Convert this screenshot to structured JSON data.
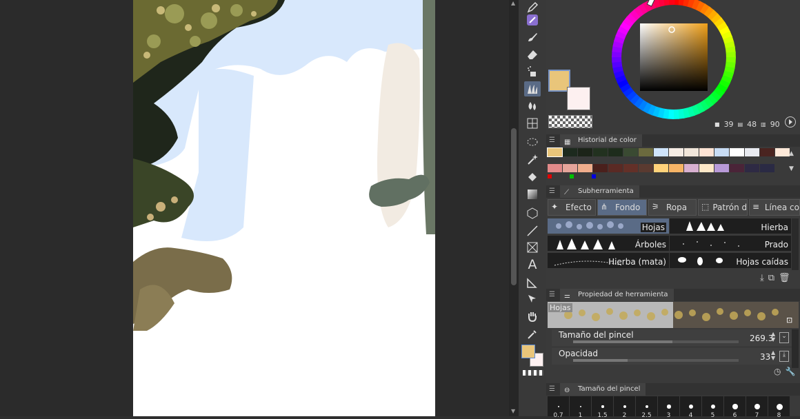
{
  "color_panel": {
    "main_color": "#e9c57a",
    "sub_color": "#fdf0f0",
    "values": {
      "h": "39",
      "s": "48",
      "v": "90"
    }
  },
  "color_history": {
    "title": "Historial de color",
    "row1": [
      "#e9c57a",
      "#1d2a1e",
      "#1c2419",
      "#22311f",
      "#1e2c1c",
      "#3a4a32",
      "#6b6a3e",
      "#cfe4fb",
      "#f5ece4",
      "#f1e6da",
      "#fde3d4",
      "#c8dcf4",
      "#ffffff",
      "#e8eaf0",
      "#4a2420",
      "#fde8d8"
    ],
    "row2": [
      "#e28a8a",
      "#e6a49a",
      "#f0ad8c",
      "#4a201c",
      "#5a2a24",
      "#633028",
      "#5a3a30",
      "#ffd27a",
      "#f6b466",
      "#d8b0d0",
      "#fde7c8",
      "#b89ad8",
      "#4a2438",
      "#2e2a44",
      "#2a2a44"
    ],
    "markers": [
      "#e00000",
      "#00c000",
      "#0000e0"
    ]
  },
  "subtool_panel": {
    "title": "Subherramienta",
    "tabs": [
      "Efecto",
      "Fondo",
      "Ropa",
      "Patrón de",
      "Línea co"
    ],
    "brushes": [
      "Hojas",
      "Hierba",
      "Árboles",
      "Prado",
      "Hierba (mata)",
      "Hojas caídas"
    ]
  },
  "tool_property": {
    "title": "Propiedad de herramienta",
    "preview_label": "Hojas",
    "brush_size_label": "Tamaño del pincel",
    "brush_size_value": "269.3",
    "brush_size_fraction": 0.6,
    "opacity_label": "Opacidad",
    "opacity_value": "33",
    "opacity_fraction": 0.33
  },
  "brush_size_panel": {
    "title": "Tamaño del pincel",
    "sizes": [
      "0.7",
      "1",
      "1.5",
      "2",
      "2.5",
      "3",
      "4",
      "5",
      "6",
      "7",
      "8"
    ]
  },
  "toolbar": {
    "tools": [
      "pen-icon",
      "pencil-icon",
      "brush-icon",
      "eraser-icon",
      "airbrush-icon",
      "decoration-icon",
      "blend-icon",
      "mesh-icon",
      "lasso-icon",
      "magic-wand-icon",
      "fill-icon",
      "gradient-icon",
      "3d-object-icon",
      "line-icon",
      "frame-icon",
      "text-icon",
      "ruler-icon",
      "operation-icon",
      "hand-icon",
      "eyedropper-icon"
    ],
    "active": "decoration-icon"
  }
}
